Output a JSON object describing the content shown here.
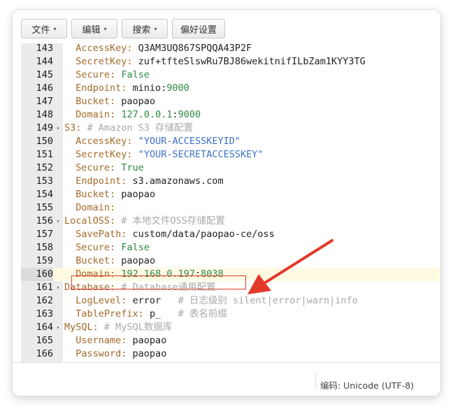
{
  "toolbar": {
    "file_label": "文件",
    "edit_label": "编辑",
    "search_label": "搜索",
    "prefs_label": "偏好设置"
  },
  "editor": {
    "lines": [
      {
        "n": "143",
        "fold": "",
        "tokens": [
          [
            "i",
            "  "
          ],
          [
            "k",
            "AccessKey:"
          ],
          [
            "t",
            " Q3AM3UQ867SPQQA43P2F"
          ]
        ]
      },
      {
        "n": "144",
        "fold": "",
        "tokens": [
          [
            "i",
            "  "
          ],
          [
            "k",
            "SecretKey:"
          ],
          [
            "t",
            " zuf+tfteSlswRu7BJ86wekitnifILbZam1KYY3TG"
          ]
        ]
      },
      {
        "n": "145",
        "fold": "",
        "tokens": [
          [
            "i",
            "  "
          ],
          [
            "k",
            "Secure:"
          ],
          [
            "t",
            " "
          ],
          [
            "s",
            "False"
          ]
        ]
      },
      {
        "n": "146",
        "fold": "",
        "tokens": [
          [
            "i",
            "  "
          ],
          [
            "k",
            "Endpoint:"
          ],
          [
            "t",
            " minio:"
          ],
          [
            "s",
            "9000"
          ]
        ]
      },
      {
        "n": "147",
        "fold": "",
        "tokens": [
          [
            "i",
            "  "
          ],
          [
            "k",
            "Bucket:"
          ],
          [
            "t",
            " paopao"
          ]
        ]
      },
      {
        "n": "148",
        "fold": "",
        "tokens": [
          [
            "i",
            "  "
          ],
          [
            "k",
            "Domain:"
          ],
          [
            "t",
            " "
          ],
          [
            "s",
            "127.0.0.1"
          ],
          [
            "t",
            ":"
          ],
          [
            "s",
            "9000"
          ]
        ]
      },
      {
        "n": "149",
        "fold": "▾",
        "tokens": [
          [
            "k",
            "S3:"
          ],
          [
            "t",
            " "
          ],
          [
            "c",
            "# Amazon S3 存储配置"
          ]
        ]
      },
      {
        "n": "150",
        "fold": "",
        "tokens": [
          [
            "i",
            "  "
          ],
          [
            "k",
            "AccessKey:"
          ],
          [
            "t",
            " "
          ],
          [
            "q",
            "\"YOUR-ACCESSKEYID\""
          ]
        ]
      },
      {
        "n": "151",
        "fold": "",
        "tokens": [
          [
            "i",
            "  "
          ],
          [
            "k",
            "SecretKey:"
          ],
          [
            "t",
            " "
          ],
          [
            "q",
            "\"YOUR-SECRETACCESSKEY\""
          ]
        ]
      },
      {
        "n": "152",
        "fold": "",
        "tokens": [
          [
            "i",
            "  "
          ],
          [
            "k",
            "Secure:"
          ],
          [
            "t",
            " "
          ],
          [
            "s",
            "True"
          ]
        ]
      },
      {
        "n": "153",
        "fold": "",
        "tokens": [
          [
            "i",
            "  "
          ],
          [
            "k",
            "Endpoint:"
          ],
          [
            "t",
            " s3.amazonaws.com"
          ]
        ]
      },
      {
        "n": "154",
        "fold": "",
        "tokens": [
          [
            "i",
            "  "
          ],
          [
            "k",
            "Bucket:"
          ],
          [
            "t",
            " paopao"
          ]
        ]
      },
      {
        "n": "155",
        "fold": "",
        "tokens": [
          [
            "i",
            "  "
          ],
          [
            "k",
            "Domain:"
          ]
        ]
      },
      {
        "n": "156",
        "fold": "▾",
        "tokens": [
          [
            "k",
            "LocalOSS:"
          ],
          [
            "t",
            " "
          ],
          [
            "c",
            "# 本地文件OSS存储配置"
          ]
        ]
      },
      {
        "n": "157",
        "fold": "",
        "tokens": [
          [
            "i",
            "  "
          ],
          [
            "k",
            "SavePath:"
          ],
          [
            "t",
            " custom/data/paopao-ce/oss"
          ]
        ]
      },
      {
        "n": "158",
        "fold": "",
        "tokens": [
          [
            "i",
            "  "
          ],
          [
            "k",
            "Secure:"
          ],
          [
            "t",
            " "
          ],
          [
            "s",
            "False"
          ]
        ]
      },
      {
        "n": "159",
        "fold": "",
        "tokens": [
          [
            "i",
            "  "
          ],
          [
            "k",
            "Bucket:"
          ],
          [
            "t",
            " paopao"
          ]
        ]
      },
      {
        "n": "160",
        "fold": "",
        "active": true,
        "tokens": [
          [
            "i",
            "  "
          ],
          [
            "k",
            "Domain:"
          ],
          [
            "t",
            " "
          ],
          [
            "s",
            "192.168.0.197"
          ],
          [
            "t",
            ":"
          ],
          [
            "s",
            "8038"
          ]
        ]
      },
      {
        "n": "161",
        "fold": "▾",
        "tokens": [
          [
            "k",
            "Database:"
          ],
          [
            "t",
            " "
          ],
          [
            "c",
            "# Database通用配置"
          ]
        ]
      },
      {
        "n": "162",
        "fold": "",
        "tokens": [
          [
            "i",
            "  "
          ],
          [
            "k",
            "LogLevel:"
          ],
          [
            "t",
            " error   "
          ],
          [
            "c",
            "# 日志级别 silent|error|warn|info"
          ]
        ]
      },
      {
        "n": "163",
        "fold": "",
        "tokens": [
          [
            "i",
            "  "
          ],
          [
            "k",
            "TablePrefix:"
          ],
          [
            "t",
            " p_   "
          ],
          [
            "c",
            "# 表名前缀"
          ]
        ]
      },
      {
        "n": "164",
        "fold": "▾",
        "tokens": [
          [
            "k",
            "MySQL:"
          ],
          [
            "t",
            " "
          ],
          [
            "c",
            "# MySQL数据库"
          ]
        ]
      },
      {
        "n": "165",
        "fold": "",
        "tokens": [
          [
            "i",
            "  "
          ],
          [
            "k",
            "Username:"
          ],
          [
            "t",
            " paopao"
          ]
        ]
      },
      {
        "n": "166",
        "fold": "",
        "tokens": [
          [
            "i",
            "  "
          ],
          [
            "k",
            "Password:"
          ],
          [
            "t",
            " paopao"
          ]
        ]
      }
    ]
  },
  "status": {
    "encoding": "编码: Unicode (UTF-8)"
  },
  "colors": {
    "key": "#a46a2a",
    "value_green": "#2e8a43",
    "string_blue": "#3c71c6",
    "comment": "#a9a9a9",
    "highlight": "#e3392b"
  }
}
